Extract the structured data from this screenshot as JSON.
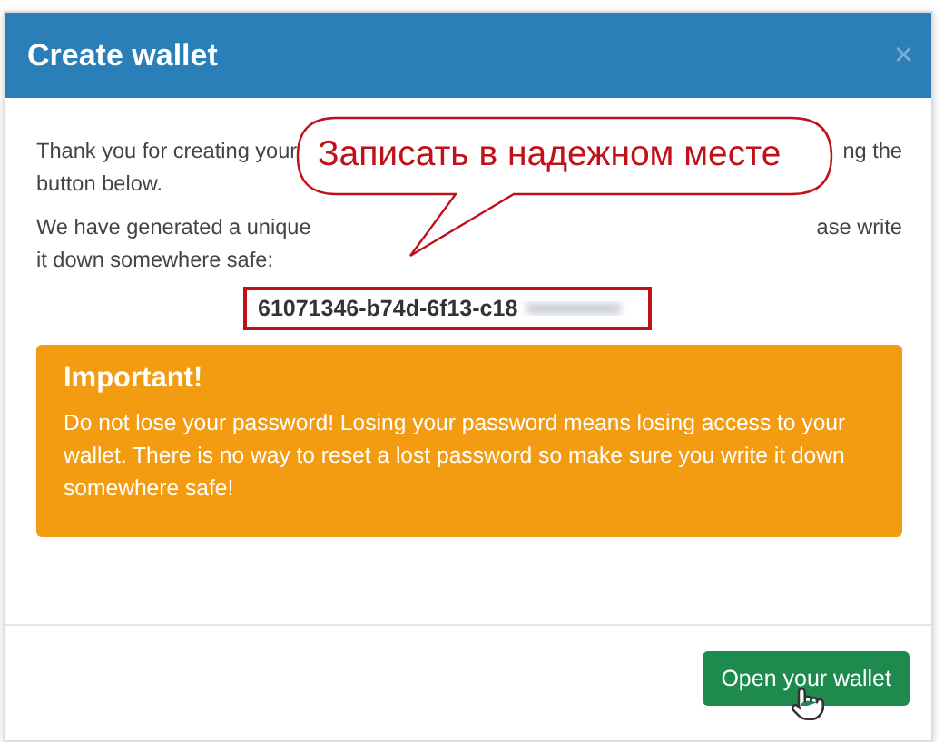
{
  "dialog": {
    "title": "Create wallet",
    "close": "×"
  },
  "intro_lines": [
    {
      "left": "Thank you for creating your",
      "right": "ng the"
    },
    {
      "left": "button below."
    }
  ],
  "id_lines": [
    {
      "left": "We have generated a unique",
      "right": "ase write"
    },
    {
      "left": "it down somewhere safe:"
    }
  ],
  "wallet_id": {
    "visible": "61071346-b74d-6f13-c18",
    "redacted": true
  },
  "callout": {
    "text": "Записать в надежном месте"
  },
  "alert": {
    "title": "Important!",
    "text": "Do not lose your password! Losing your password means losing access to your wallet. There is no way to reset a lost password so make sure you write it down somewhere safe!"
  },
  "footer": {
    "button": "Open your wallet",
    "cursor": true
  }
}
